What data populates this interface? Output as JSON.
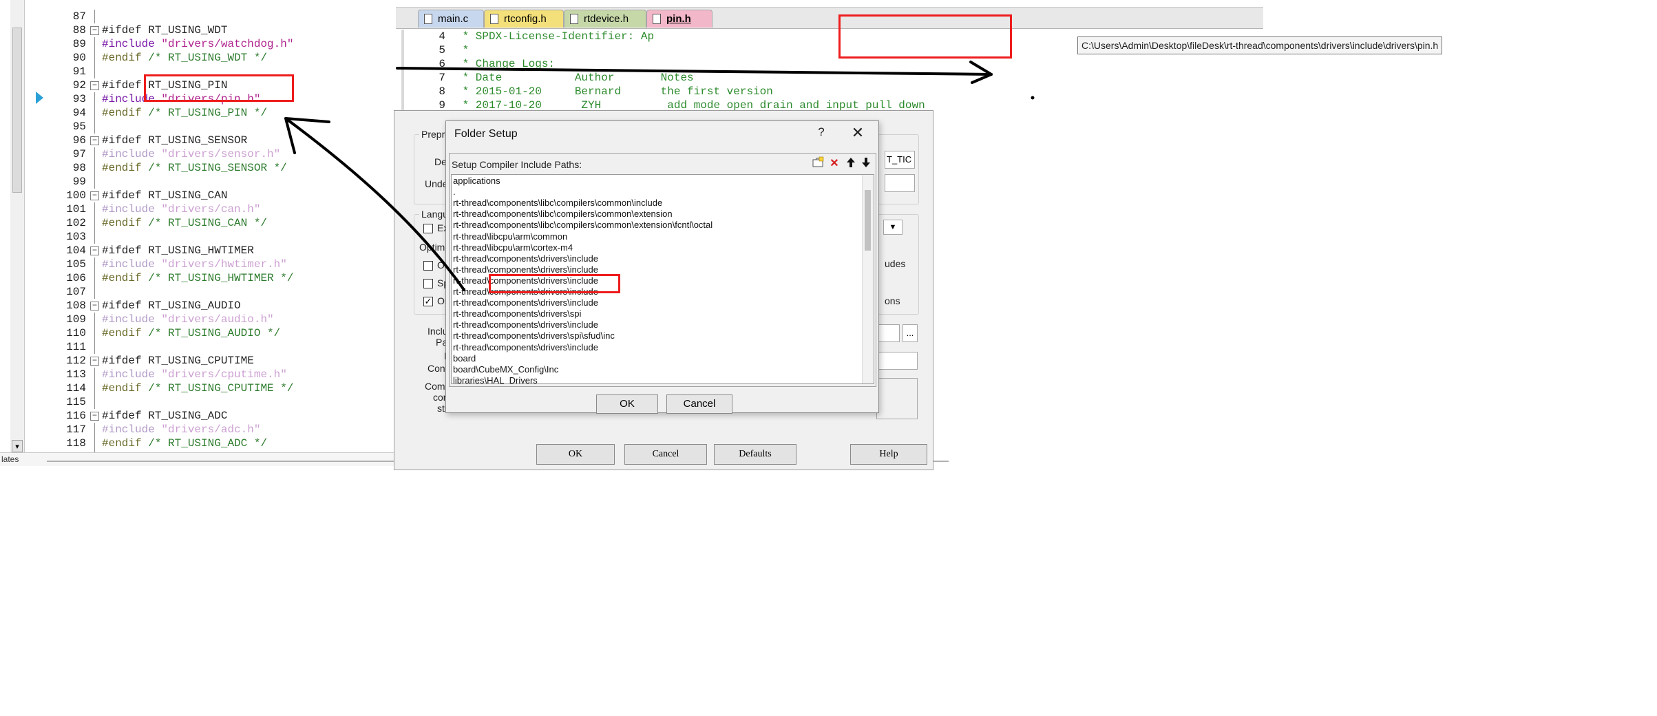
{
  "left_editor": {
    "lines": [
      {
        "n": "87",
        "text": "",
        "fold": false
      },
      {
        "n": "88",
        "text": "#ifdef RT_USING_WDT",
        "fold": true,
        "kind": "dir"
      },
      {
        "n": "89",
        "text": "#include \"drivers/watchdog.h\"",
        "kind": "inc-active"
      },
      {
        "n": "90",
        "text": "#endif /* RT_USING_WDT */",
        "kind": "end"
      },
      {
        "n": "91",
        "text": "",
        "kind": "blank"
      },
      {
        "n": "92",
        "text": "#ifdef RT_USING_PIN",
        "fold": true,
        "kind": "dir"
      },
      {
        "n": "93",
        "text": "#include \"drivers/pin.h\"",
        "kind": "inc-active"
      },
      {
        "n": "94",
        "text": "#endif /* RT_USING_PIN */",
        "kind": "end"
      },
      {
        "n": "95",
        "text": "",
        "kind": "blank"
      },
      {
        "n": "96",
        "text": "#ifdef RT_USING_SENSOR",
        "fold": true,
        "kind": "dir"
      },
      {
        "n": "97",
        "text": "#include \"drivers/sensor.h\"",
        "kind": "inc-dim"
      },
      {
        "n": "98",
        "text": "#endif /* RT_USING_SENSOR */",
        "kind": "end"
      },
      {
        "n": "99",
        "text": "",
        "kind": "blank"
      },
      {
        "n": "100",
        "text": "#ifdef RT_USING_CAN",
        "fold": true,
        "kind": "dir"
      },
      {
        "n": "101",
        "text": "#include \"drivers/can.h\"",
        "kind": "inc-dim"
      },
      {
        "n": "102",
        "text": "#endif /* RT_USING_CAN */",
        "kind": "end"
      },
      {
        "n": "103",
        "text": "",
        "kind": "blank"
      },
      {
        "n": "104",
        "text": "#ifdef RT_USING_HWTIMER",
        "fold": true,
        "kind": "dir"
      },
      {
        "n": "105",
        "text": "#include \"drivers/hwtimer.h\"",
        "kind": "inc-dim"
      },
      {
        "n": "106",
        "text": "#endif /* RT_USING_HWTIMER */",
        "kind": "end"
      },
      {
        "n": "107",
        "text": "",
        "kind": "blank"
      },
      {
        "n": "108",
        "text": "#ifdef RT_USING_AUDIO",
        "fold": true,
        "kind": "dir"
      },
      {
        "n": "109",
        "text": "#include \"drivers/audio.h\"",
        "kind": "inc-dim"
      },
      {
        "n": "110",
        "text": "#endif /* RT_USING_AUDIO */",
        "kind": "end"
      },
      {
        "n": "111",
        "text": "",
        "kind": "blank"
      },
      {
        "n": "112",
        "text": "#ifdef RT_USING_CPUTIME",
        "fold": true,
        "kind": "dir"
      },
      {
        "n": "113",
        "text": "#include \"drivers/cputime.h\"",
        "kind": "inc-dim"
      },
      {
        "n": "114",
        "text": "#endif /* RT_USING_CPUTIME */",
        "kind": "end"
      },
      {
        "n": "115",
        "text": "",
        "kind": "blank"
      },
      {
        "n": "116",
        "text": "#ifdef RT_USING_ADC",
        "fold": true,
        "kind": "dir"
      },
      {
        "n": "117",
        "text": "#include \"drivers/adc.h\"",
        "kind": "inc-dim"
      },
      {
        "n": "118",
        "text": "#endif /* RT_USING_ADC */",
        "kind": "end"
      },
      {
        "n": "119",
        "text": "",
        "kind": "blank"
      }
    ],
    "bottom_tab": "lates"
  },
  "editor_tabs": [
    {
      "label": "main.c",
      "active": false
    },
    {
      "label": "rtconfig.h",
      "active": false
    },
    {
      "label": "rtdevice.h",
      "active": false
    },
    {
      "label": "pin.h",
      "active": true
    }
  ],
  "right_editor": {
    "lines": [
      {
        "n": "4",
        "text": " * SPDX-License-Identifier: Ap"
      },
      {
        "n": "5",
        "text": " *"
      },
      {
        "n": "6",
        "text": " * Change Logs:"
      },
      {
        "n": "7",
        "text": " * Date           Author       Notes"
      },
      {
        "n": "8",
        "text": " * 2015-01-20     Bernard      the first version"
      },
      {
        "n": "9",
        "text": " * 2017-10-20      ZYH          add mode open drain and input pull down"
      }
    ],
    "tooltip": "C:\\Users\\Admin\\Desktop\\fileDesk\\rt-thread\\components\\drivers\\include\\drivers\\pin.h"
  },
  "options_dialog": {
    "group_preprocessor": "Prepro",
    "define_label": "Def",
    "define_value": "T_TIC",
    "undefine_label": "Undef",
    "group_language": "Langu",
    "check_ex": "Ex",
    "optim_label": "Optimi",
    "check_op": "Op",
    "check_sp": "Sp",
    "check_on": "On",
    "right_text_udes": "udes",
    "right_text_ons": "ons",
    "include_label": "Inclu",
    "paths_label": "Path",
    "misc_label": "M",
    "controls_label": "Contr",
    "compiler_label": "Comp",
    "control_label2": "cont",
    "string_label": "stri",
    "browse_button": "...",
    "ok_button": "OK",
    "cancel_button": "Cancel",
    "defaults_button": "Defaults",
    "help_button": "Help"
  },
  "folder_setup": {
    "title": "Folder Setup",
    "help_glyph": "?",
    "close_glyph": "✕",
    "header": "Setup Compiler Include Paths:",
    "paths": [
      "applications",
      ".",
      "rt-thread\\components\\libc\\compilers\\common\\include",
      "rt-thread\\components\\libc\\compilers\\common\\extension",
      "rt-thread\\components\\libc\\compilers\\common\\extension\\fcntl\\octal",
      "rt-thread\\libcpu\\arm\\common",
      "rt-thread\\libcpu\\arm\\cortex-m4",
      "rt-thread\\components\\drivers\\include",
      "rt-thread\\components\\drivers\\include",
      "rt-thread\\components\\drivers\\include",
      "rt-thread\\components\\drivers\\include",
      "rt-thread\\components\\drivers\\include",
      "rt-thread\\components\\drivers\\spi",
      "rt-thread\\components\\drivers\\include",
      "rt-thread\\components\\drivers\\spi\\sfud\\inc",
      "rt-thread\\components\\drivers\\include",
      "board",
      "board\\CubeMX_Config\\Inc",
      "libraries\\HAL_Drivers"
    ],
    "ok_button": "OK",
    "cancel_button": "Cancel"
  },
  "colors": {
    "annotation_red": "#ee1c1c",
    "annotation_arrow": "#000000",
    "tab_main": "#c7d7ee",
    "tab_rtconfig": "#f3e07a",
    "tab_rtdevice": "#c6d8a8",
    "tab_pin": "#f2b7c9"
  }
}
